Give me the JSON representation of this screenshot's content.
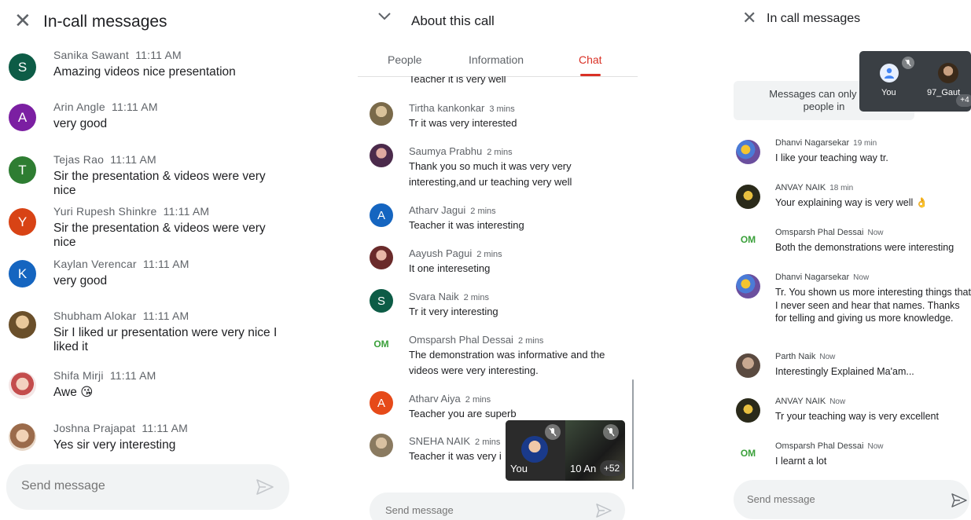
{
  "panel1": {
    "title": "In-call messages",
    "close_icon": "close-icon",
    "messages": [
      {
        "initial": "S",
        "color": "#0d5c46",
        "sender": "Sanika Sawant",
        "time": "11:11 AM",
        "text": "Amazing videos nice presentation"
      },
      {
        "initial": "A",
        "color": "#7b1fa2",
        "sender": "Arin Angle",
        "time": "11:11 AM",
        "text": "very good"
      },
      {
        "initial": "T",
        "color": "#2e7d32",
        "sender": "Tejas Rao",
        "time": "11:11 AM",
        "text": "Sir the presentation & videos were very nice"
      },
      {
        "initial": "Y",
        "color": "#d84315",
        "sender": "Yuri Rupesh Shinkre",
        "time": "11:11 AM",
        "text": "Sir the presentation & videos were very nice"
      },
      {
        "initial": "K",
        "color": "#1565c0",
        "sender": "Kaylan Verencar",
        "time": "11:11 AM",
        "text": "very good"
      },
      {
        "initial": "",
        "color": "#a8844f",
        "sender": "Shubham Alokar",
        "time": "11:11 AM",
        "text": "Sir I liked ur presentation were very nice I liked it"
      },
      {
        "initial": "",
        "color": "#c48f8f",
        "sender": "Shifa Mirji",
        "time": "11:11 AM",
        "text": "Awe 😘"
      },
      {
        "initial": "",
        "color": "#c9a58c",
        "sender": "Joshna Prajapat",
        "time": "11:11 AM",
        "text": "Yes sir very interesting"
      }
    ],
    "compose_placeholder": "Send message"
  },
  "panel2": {
    "title": "About this call",
    "tabs": [
      {
        "label": "People",
        "active": false
      },
      {
        "label": "Information",
        "active": false
      },
      {
        "label": "Chat",
        "active": true
      }
    ],
    "partial_text": "Teacher it is very  well",
    "messages": [
      {
        "initial": "",
        "color": "#9e8e6e",
        "sender": "Tirtha kankonkar",
        "time": "3 mins",
        "text": "Tr it was very interested"
      },
      {
        "initial": "",
        "color": "#6a4a6a",
        "sender": "Saumya Prabhu",
        "time": "2 mins",
        "text": "Thank you so much it was very very interesting,and ur teaching very well"
      },
      {
        "initial": "A",
        "color": "#1565c0",
        "sender": "Atharv Jagui",
        "time": "2 mins",
        "text": "Teacher it was interesting"
      },
      {
        "initial": "",
        "color": "#8a4b4b",
        "sender": "Aayush Pagui",
        "time": "2 mins",
        "text": "It one intereseting"
      },
      {
        "initial": "S",
        "color": "#0d5c46",
        "sender": "Svara Naik",
        "time": "2 mins",
        "text": "Tr it very interesting"
      },
      {
        "initial": "OM",
        "color": "#ffffff",
        "sender": "Omsparsh Phal Dessai",
        "time": "2 mins",
        "text": "The demonstration was informative and the videos were very interesting."
      },
      {
        "initial": "A",
        "color": "#e64a19",
        "sender": "Atharv Aiya",
        "time": "2 mins",
        "text": "Teacher you are superb"
      },
      {
        "initial": "",
        "color": "#b09a80",
        "sender": "SNEHA NAIK",
        "time": "2 mins",
        "text": "Teacher it was very i"
      }
    ],
    "pip": {
      "self_label": "You",
      "other_label": "10  An",
      "more_count": "+52"
    },
    "compose_placeholder": "Send message"
  },
  "panel3": {
    "title": "In call messages",
    "notice_line1": "Messages can only be s",
    "notice_line2": "people in",
    "pip": {
      "self_label": "You",
      "other_label": "97_Gaut",
      "more_count": "+4"
    },
    "messages": [
      {
        "initial": "",
        "color": "#6b4f9e",
        "sender": "Dhanvi Nagarsekar",
        "time": "19 min",
        "text": "I like your teaching way tr."
      },
      {
        "initial": "",
        "color": "#8a7a3a",
        "sender": "ANVAY NAIK",
        "time": "18 min",
        "text": "Your explaining way is very well 👌"
      },
      {
        "initial": "OM",
        "color": "#ffffff",
        "sender": "Omsparsh Phal Dessai",
        "time": "Now",
        "text": "Both the demonstrations were interesting"
      },
      {
        "initial": "",
        "color": "#6b4f9e",
        "sender": "Dhanvi Nagarsekar",
        "time": "Now",
        "text": "Tr. You shown us more interesting things that I never seen and hear that names. Thanks for telling and giving us more knowledge."
      },
      {
        "initial": "",
        "color": "#7a6a60",
        "sender": "Parth Naik",
        "time": "Now",
        "text": "Interestingly Explained Ma'am..."
      },
      {
        "initial": "",
        "color": "#8a7a3a",
        "sender": "ANVAY NAIK",
        "time": "Now",
        "text": "Tr your teaching way is very excellent"
      },
      {
        "initial": "OM",
        "color": "#ffffff",
        "sender": "Omsparsh Phal Dessai",
        "time": "Now",
        "text": "I learnt a lot"
      }
    ],
    "compose_placeholder": "Send message"
  }
}
